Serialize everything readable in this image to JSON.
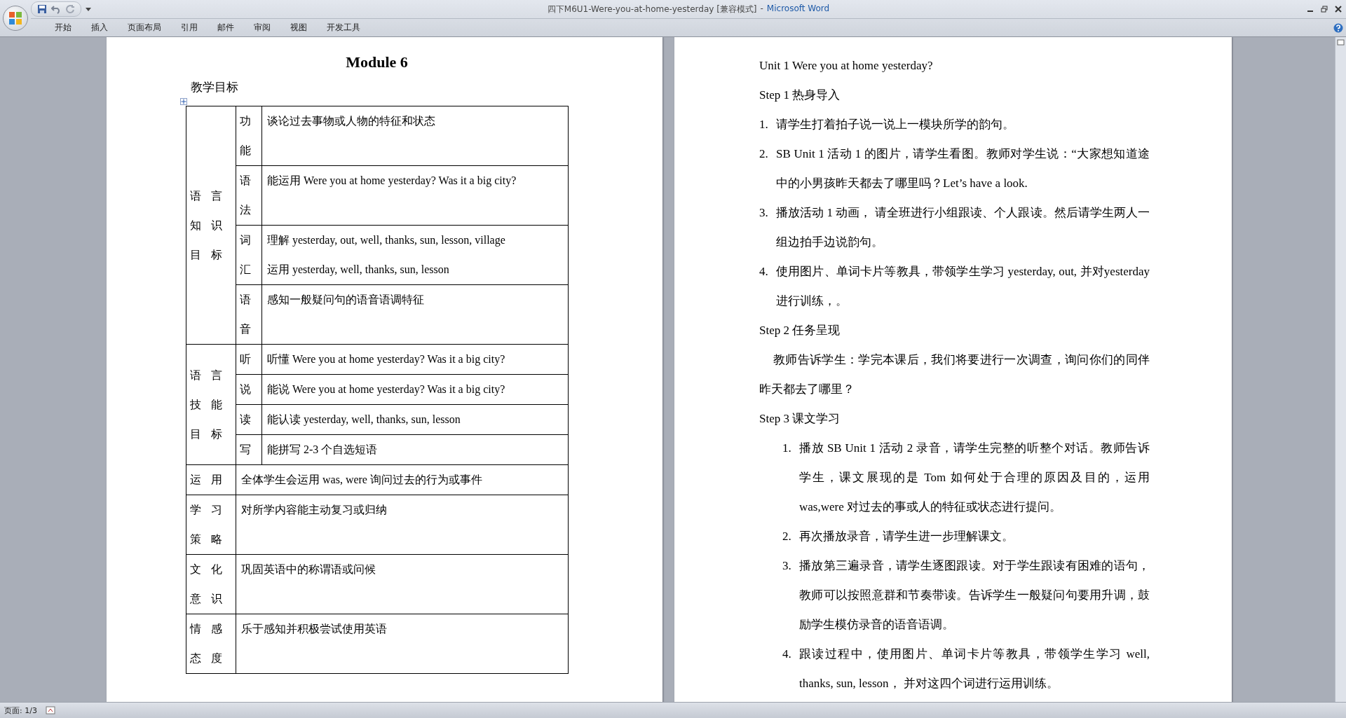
{
  "window": {
    "title": "四下M6U1-Were-you-at-home-yesterday [兼容模式]",
    "separator": "-",
    "app": "Microsoft Word"
  },
  "ribbon_tabs": [
    "开始",
    "插入",
    "页面布局",
    "引用",
    "邮件",
    "审阅",
    "视图",
    "开发工具"
  ],
  "left_page": {
    "heading": "Module 6",
    "subheading": "教学目标",
    "table": {
      "groups": [
        {
          "category": "语言知识目标",
          "items": [
            {
              "aspect": "功能",
              "lines": [
                "谈论过去事物或人物的特征和状态"
              ]
            },
            {
              "aspect": "语法",
              "lines": [
                "能运用 Were you at home yesterday? Was it a big city?"
              ]
            },
            {
              "aspect": "词汇",
              "lines": [
                "理解 yesterday, out, well, thanks, sun, lesson, village",
                "运用 yesterday, well, thanks, sun, lesson"
              ]
            },
            {
              "aspect": "语音",
              "lines": [
                "感知一般疑问句的语音语调特征"
              ]
            }
          ]
        },
        {
          "category": "语言技能目标",
          "items": [
            {
              "aspect": "听",
              "lines": [
                "听懂 Were you at home yesterday? Was it a big city?"
              ]
            },
            {
              "aspect": "说",
              "lines": [
                "能说 Were you at home yesterday? Was it a big city?"
              ]
            },
            {
              "aspect": "读",
              "lines": [
                "能认读 yesterday, well, thanks, sun, lesson"
              ]
            },
            {
              "aspect": "写",
              "lines": [
                "能拼写 2-3 个自选短语"
              ]
            }
          ]
        }
      ],
      "rows": [
        {
          "category": "运用",
          "content": "全体学生会运用 was, were 询问过去的行为或事件"
        },
        {
          "category": "学习策略",
          "content": "对所学内容能主动复习或归纳"
        },
        {
          "category": "文化意识",
          "content": "巩固英语中的称谓语或问候"
        },
        {
          "category": "情感态度",
          "content": "乐于感知并积极尝试使用英语"
        }
      ]
    }
  },
  "right_page": {
    "paragraphs": [
      {
        "kind": "plain",
        "text": "Unit 1 Were you at home yesterday?"
      },
      {
        "kind": "plain",
        "text": "Step 1  热身导入"
      },
      {
        "kind": "numbered",
        "number": "1.",
        "text": "请学生打着拍子说一说上一模块所学的韵句。"
      },
      {
        "kind": "numbered",
        "number": "2.",
        "text": "SB Unit 1 活动 1 的图片，请学生看图。教师对学生说：“大家想知道途中的小男孩昨天都去了哪里吗？Let’s have a look."
      },
      {
        "kind": "numbered",
        "number": "3.",
        "text": "播放活动 1 动画，  请全班进行小组跟读、个人跟读。然后请学生两人一组边拍手边说韵句。"
      },
      {
        "kind": "numbered",
        "number": "4.",
        "text": "使用图片、单词卡片等教具，带领学生学习 yesterday, out, 并对yesterday 进行训练，。"
      },
      {
        "kind": "plain",
        "text": "Step 2  任务呈现"
      },
      {
        "kind": "body",
        "text": "教师告诉学生：学完本课后，我们将要进行一次调查，询问你们的同伴昨天都去了哪里？"
      },
      {
        "kind": "plain",
        "text": "Step 3  课文学习"
      },
      {
        "kind": "subnumbered",
        "number": "1.",
        "text": "播放 SB Unit 1 活动 2  录音，请学生完整的听整个对话。教师告诉学生，课文展现的是 Tom 如何处于合理的原因及目的，运用 was,were 对过去的事或人的特征或状态进行提问。"
      },
      {
        "kind": "subnumbered",
        "number": "2.",
        "text": "再次播放录音，请学生进一步理解课文。"
      },
      {
        "kind": "subnumbered",
        "number": "3.",
        "text": "播放第三遍录音，请学生逐图跟读。对于学生跟读有困难的语句，教师可以按照意群和节奏带读。告诉学生一般疑问句要用升调，鼓励学生模仿录音的语音语调。"
      },
      {
        "kind": "subnumbered",
        "number": "4.",
        "text": "跟读过程中，使用图片、单词卡片等教具，带领学生学习 well, thanks, sun, lesson，  并对这四个词进行运用训练。"
      }
    ]
  },
  "status_bar": {
    "page": "页面: 1/3"
  }
}
